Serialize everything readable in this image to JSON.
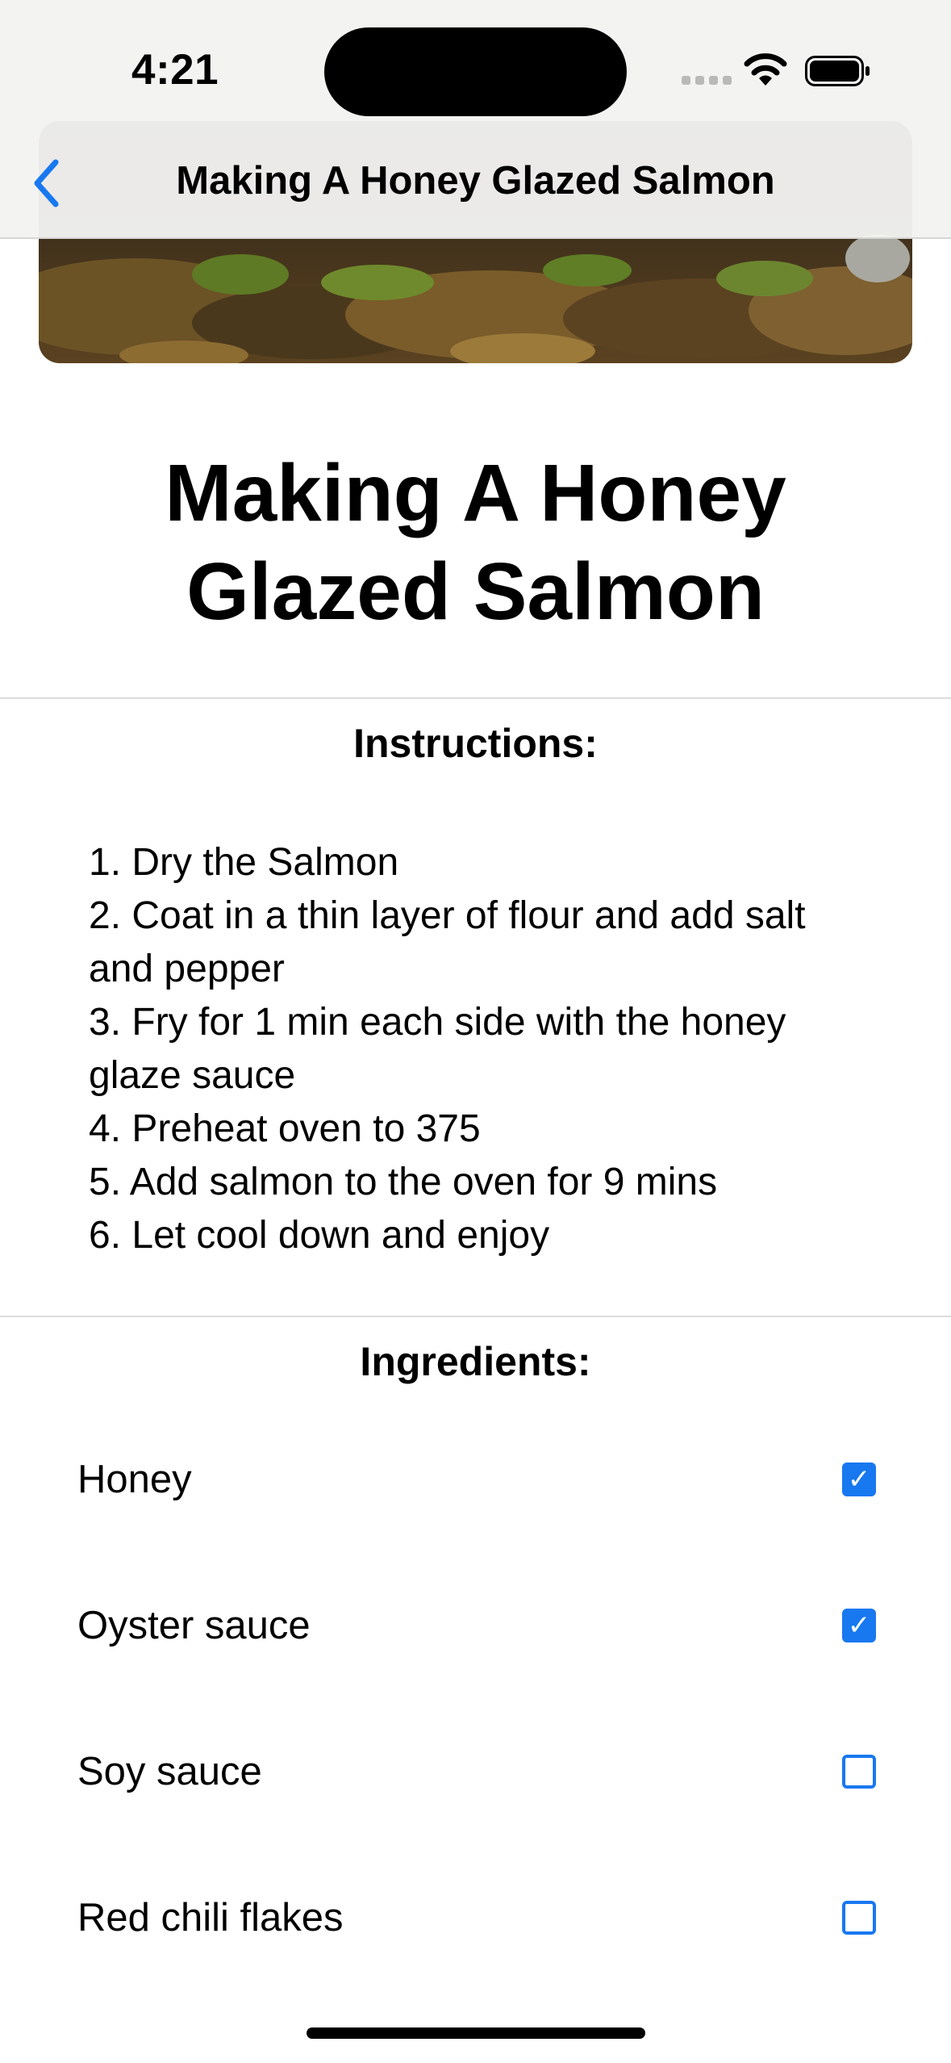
{
  "status_bar": {
    "time": "4:21"
  },
  "nav_bar": {
    "back_icon": "chevron-left-icon",
    "title": "Making A Honey Glazed Salmon",
    "accent_color": "#1878f0"
  },
  "recipe": {
    "title_line1": "Making A Honey",
    "title_line2": "Glazed Salmon",
    "instructions_heading": "Instructions:",
    "instructions": [
      "1. Dry the Salmon",
      "2. Coat in a thin layer of flour and add salt and pepper",
      "3. Fry for 1 min each side with the honey glaze sauce",
      "4. Preheat oven to 375",
      "5. Add salmon to the oven for 9 mins",
      "6. Let cool down and enjoy"
    ],
    "ingredients_heading": "Ingredients:",
    "ingredients": [
      {
        "label": "Honey",
        "checked": true
      },
      {
        "label": "Oyster sauce",
        "checked": true
      },
      {
        "label": "Soy sauce",
        "checked": false
      },
      {
        "label": "Red chili flakes",
        "checked": false
      }
    ]
  }
}
